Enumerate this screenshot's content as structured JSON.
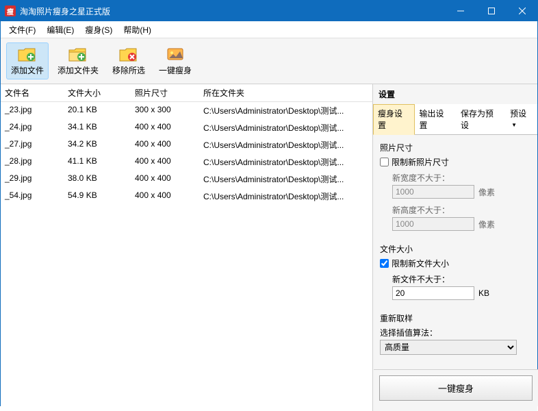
{
  "window": {
    "title": "淘淘照片瘦身之星正式版"
  },
  "menu": {
    "file": "文件(F)",
    "edit": "编辑(E)",
    "slim": "瘦身(S)",
    "help": "帮助(H)"
  },
  "toolbar": {
    "add_file": "添加文件",
    "add_folder": "添加文件夹",
    "remove_sel": "移除所选",
    "one_key": "一键瘦身"
  },
  "columns": {
    "name": "文件名",
    "size": "文件大小",
    "dim": "照片尺寸",
    "folder": "所在文件夹"
  },
  "rows": [
    {
      "name": "_23.jpg",
      "size": "20.1 KB",
      "dim": "300 x 300",
      "folder": "C:\\Users\\Administrator\\Desktop\\测试..."
    },
    {
      "name": "_24.jpg",
      "size": "34.1 KB",
      "dim": "400 x 400",
      "folder": "C:\\Users\\Administrator\\Desktop\\测试..."
    },
    {
      "name": "_27.jpg",
      "size": "34.2 KB",
      "dim": "400 x 400",
      "folder": "C:\\Users\\Administrator\\Desktop\\测试..."
    },
    {
      "name": "_28.jpg",
      "size": "41.1 KB",
      "dim": "400 x 400",
      "folder": "C:\\Users\\Administrator\\Desktop\\测试..."
    },
    {
      "name": "_29.jpg",
      "size": "38.0 KB",
      "dim": "400 x 400",
      "folder": "C:\\Users\\Administrator\\Desktop\\测试..."
    },
    {
      "name": "_54.jpg",
      "size": "54.9 KB",
      "dim": "400 x 400",
      "folder": "C:\\Users\\Administrator\\Desktop\\测试..."
    }
  ],
  "settings": {
    "title": "设置",
    "tab_slim": "瘦身设置",
    "tab_output": "输出设置",
    "tab_preset_save": "保存为预设",
    "tab_preset": "预设",
    "photo_size": "照片尺寸",
    "limit_photo": "限制新照片尺寸",
    "new_width_label": "新宽度不大于：",
    "new_width_val": "1000",
    "new_height_label": "新高度不大于：",
    "new_height_val": "1000",
    "px": "像素",
    "file_size": "文件大小",
    "limit_file": "限制新文件大小",
    "new_file_label": "新文件不大于：",
    "new_file_val": "20",
    "kb": "KB",
    "resample": "重新取样",
    "algo_label": "选择插值算法：",
    "algo_val": "高质量",
    "run": "一键瘦身"
  }
}
